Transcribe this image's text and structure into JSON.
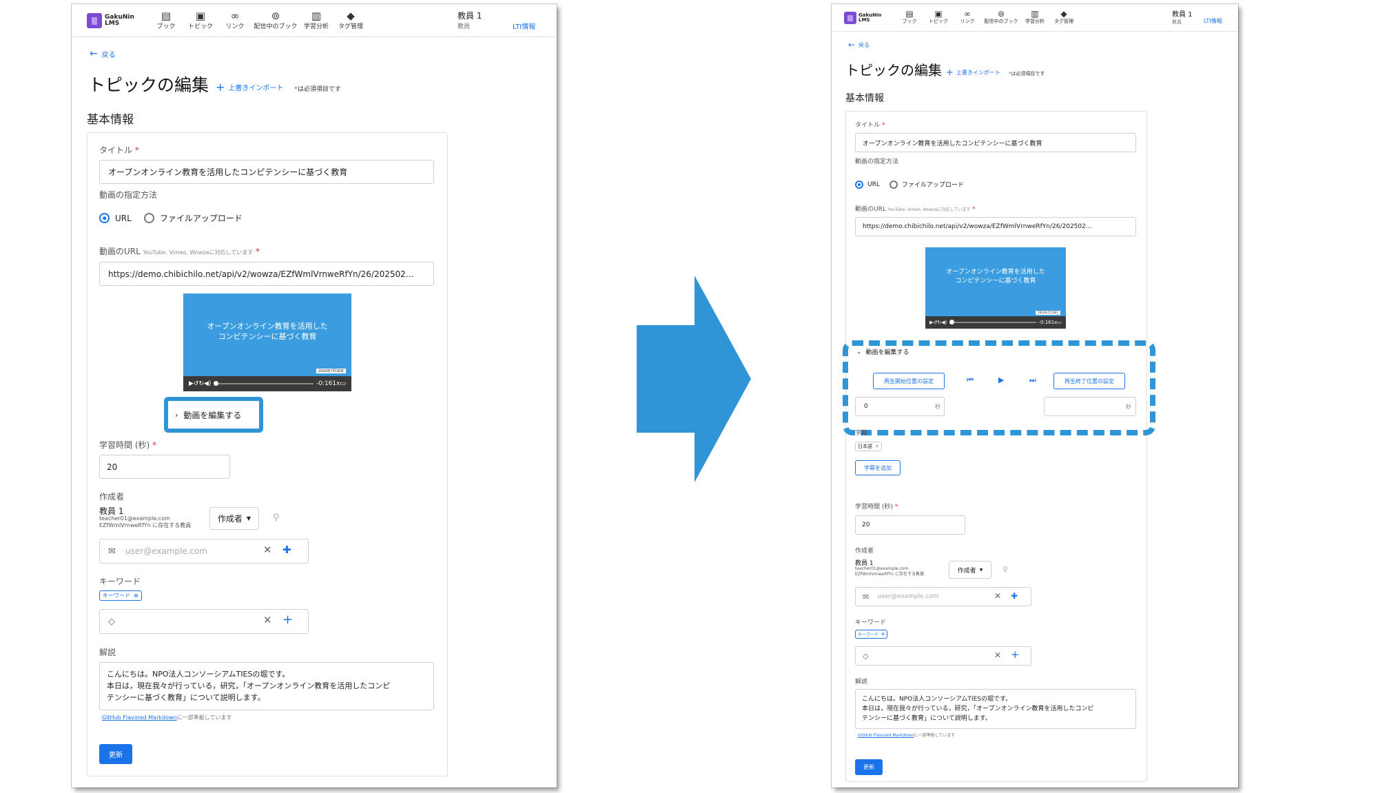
{
  "app": {
    "logo_line1": "GakuNin",
    "logo_line2": "LMS",
    "nav": [
      {
        "label": "ブック",
        "icon": "book-icon"
      },
      {
        "label": "トピック",
        "icon": "topic-icon"
      },
      {
        "label": "リンク",
        "icon": "link-icon"
      },
      {
        "label": "配信中のブック",
        "icon": "broadcast-icon"
      },
      {
        "label": "学習分析",
        "icon": "analytics-icon"
      },
      {
        "label": "タグ管理",
        "icon": "tag-icon"
      }
    ],
    "user_name": "教員 1",
    "user_role": "教員",
    "lti_link": "LTI情報"
  },
  "page": {
    "back": "戻る",
    "title": "トピックの編集",
    "import": "上書きインポート",
    "required_note": "は必須項目です",
    "section": "基本情報"
  },
  "form": {
    "title_label": "タイトル",
    "title_value": "オープンオンライン教育を活用したコンピテンシーに基づく教育",
    "video_method_label": "動画の指定方法",
    "radio_url": "URL",
    "radio_upload": "ファイルアップロード",
    "video_url_label": "動画のURL",
    "video_url_hint": "YouTube, Vimeo, Wowzaに対応しています",
    "video_url_value": "https://demo.chibichilo.net/api/v2/wowza/EZfWmlVrnweRfYn/26/202502…",
    "video_caption_line1": "オープンオンライン教育を活用した",
    "video_caption_line2": "コンピテンシーに基づく教育",
    "video_date": "2024年7月18日",
    "video_time": "-0:16",
    "video_speed": "1x",
    "edit_video": "動画を編集する",
    "study_time_label": "学習時間 (秒)",
    "study_time_value": "20",
    "author_label": "作成者",
    "author_name": "教員 1",
    "author_email": "teacher01@example.com",
    "author_note": "EZfWmlVrnweRfYn に存在する教員",
    "author_role_select": "作成者",
    "author_input_placeholder": "user@example.com",
    "keyword_label": "キーワード",
    "keyword_chip": "キーワード",
    "description_label": "解説",
    "description_line1": "こんにちは。NPO法人コンソーシアムTIESの堀です。",
    "description_line2": "本日は，現在我々が行っている，研究，「オープンオンライン教育を活用したコンピ",
    "description_line3": "テンシーに基づく教育」について説明します。",
    "md_link": "GitHub Flavored Markdown",
    "md_note": "に一部準拠しています",
    "submit": "更新"
  },
  "editor": {
    "start_button": "再生開始位置の設定",
    "end_button": "再生終了位置の設定",
    "start_value": "0",
    "sec_unit": "秒",
    "subtitle_label": "字幕",
    "subtitle_chip": "日本語",
    "add_subtitle": "字幕を追加"
  },
  "colors": {
    "accent": "#1a73e8",
    "highlight": "#2f95d6",
    "logo": "#7b4bd0"
  }
}
